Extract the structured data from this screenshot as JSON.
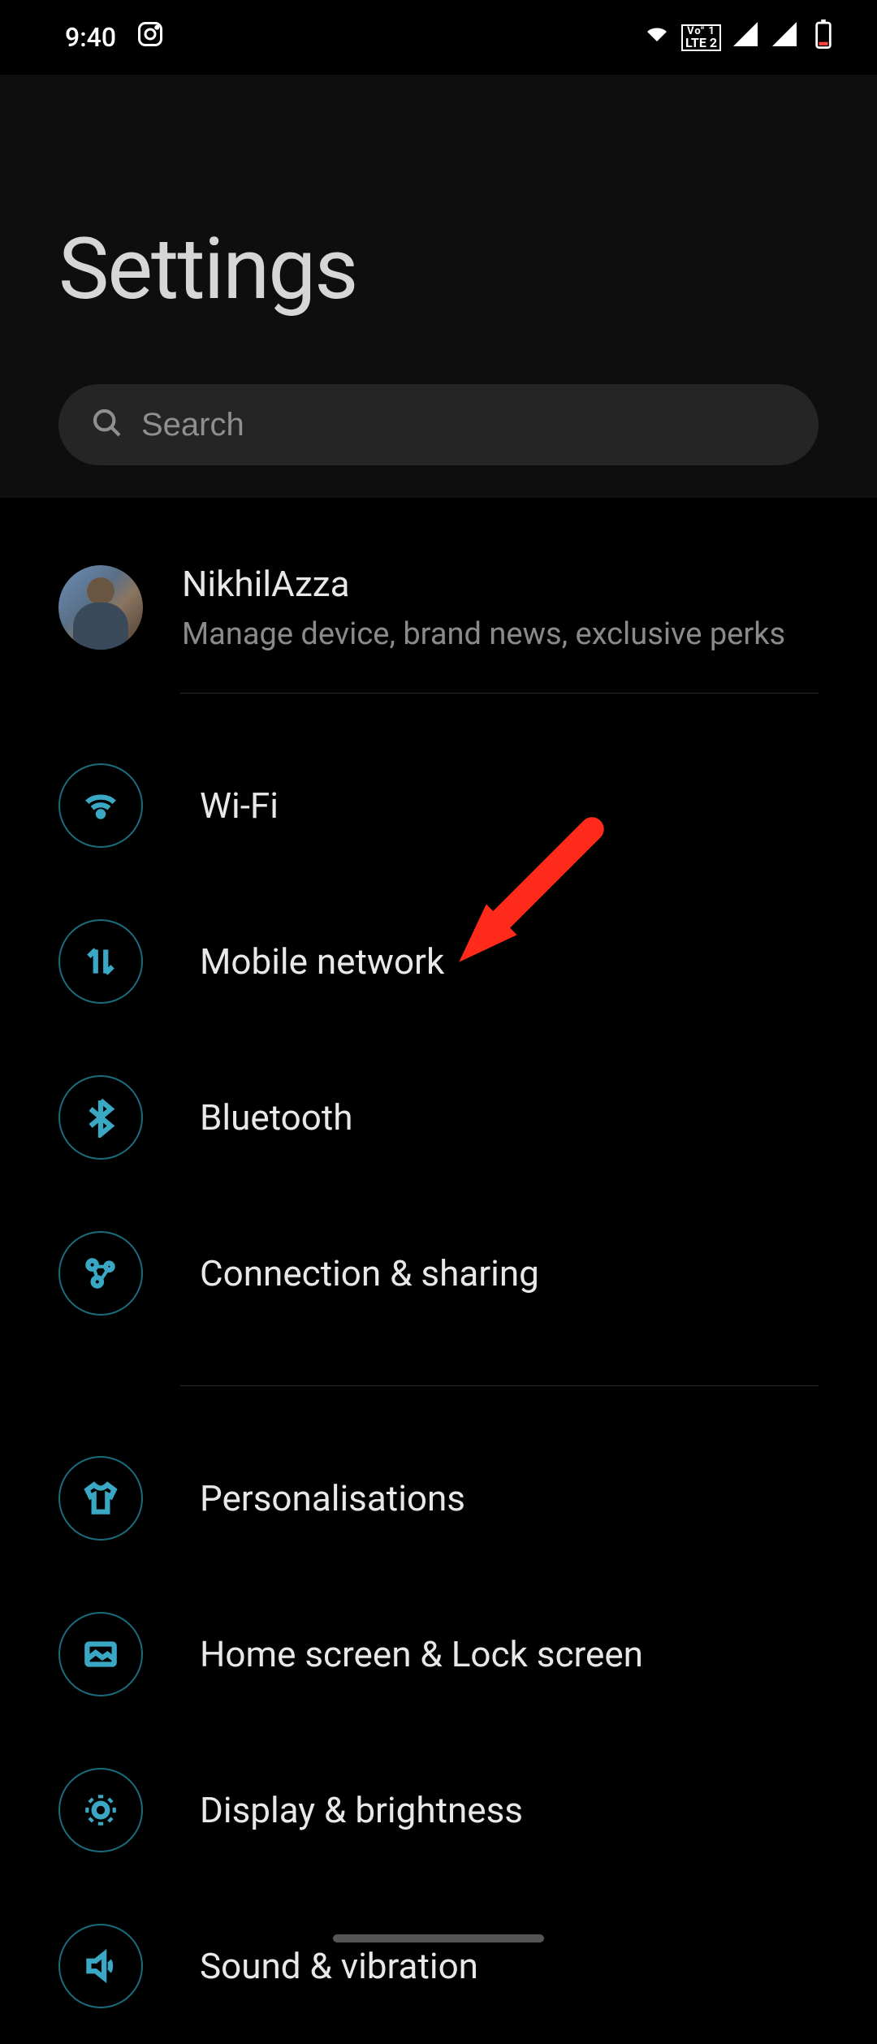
{
  "status": {
    "time": "9:40"
  },
  "title": "Settings",
  "search": {
    "placeholder": "Search"
  },
  "account": {
    "name": "NikhilAzza",
    "subtitle": "Manage device, brand news, exclusive perks"
  },
  "items": [
    {
      "label": "Wi-Fi",
      "icon": "wifi"
    },
    {
      "label": "Mobile network",
      "icon": "mobile-data"
    },
    {
      "label": "Bluetooth",
      "icon": "bluetooth"
    },
    {
      "label": "Connection & sharing",
      "icon": "connection"
    },
    {
      "label": "Personalisations",
      "icon": "shirt"
    },
    {
      "label": "Home screen & Lock screen",
      "icon": "image"
    },
    {
      "label": "Display & brightness",
      "icon": "brightness"
    },
    {
      "label": "Sound & vibration",
      "icon": "sound"
    }
  ]
}
